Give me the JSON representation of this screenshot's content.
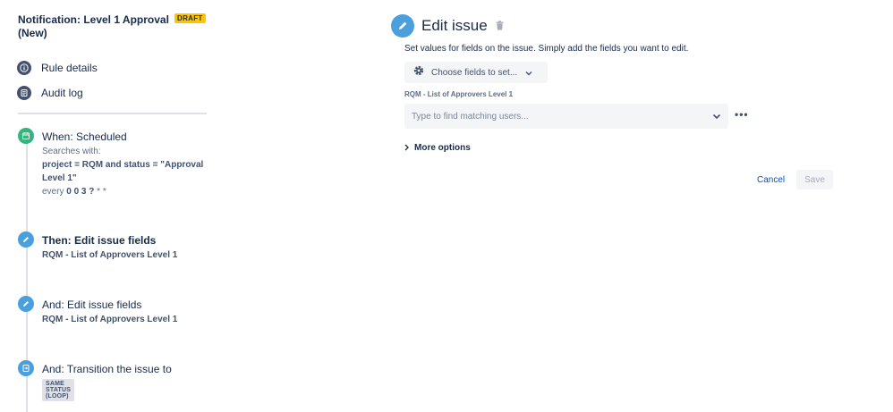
{
  "rule": {
    "title": "Notification: Level 1 Approval (New)",
    "badge": "DRAFT"
  },
  "nav": {
    "rule_details": "Rule details",
    "audit_log": "Audit log"
  },
  "steps": [
    {
      "title": "When: Scheduled",
      "line1": "Searches with:",
      "line2": "project = RQM and status = \"Approval",
      "line3": "Level 1\"",
      "line4_prefix": "every ",
      "line4_bold": "0 0 3 ?",
      "line4_suffix": " * *",
      "icon": "calendar-icon",
      "color": "#36b37e"
    },
    {
      "title": "Then: Edit issue fields",
      "sub": "RQM - List of Approvers Level 1",
      "icon": "pencil-icon",
      "color": "#4a9fdd"
    },
    {
      "title": "And: Edit issue fields",
      "sub": "RQM - List of Approvers Level 1",
      "icon": "pencil-icon",
      "color": "#4a9fdd"
    },
    {
      "title": "And: Transition the issue to",
      "lozenge": "SAME STATUS (LOOP)",
      "icon": "transition-icon",
      "color": "#4a9fdd"
    }
  ],
  "editor": {
    "title": "Edit issue",
    "description": "Set values for fields on the issue. Simply add the fields you want to edit.",
    "choose_fields": "Choose fields to set...",
    "field_label": "RQM - List of Approvers Level 1",
    "user_placeholder": "Type to find matching users...",
    "more_dots": "•••",
    "more_options": "More options",
    "cancel": "Cancel",
    "save": "Save"
  },
  "colors": {
    "accent": "#4a9fdd",
    "scheduled": "#36b37e",
    "draft": "#ffc400",
    "link": "#0052cc"
  }
}
